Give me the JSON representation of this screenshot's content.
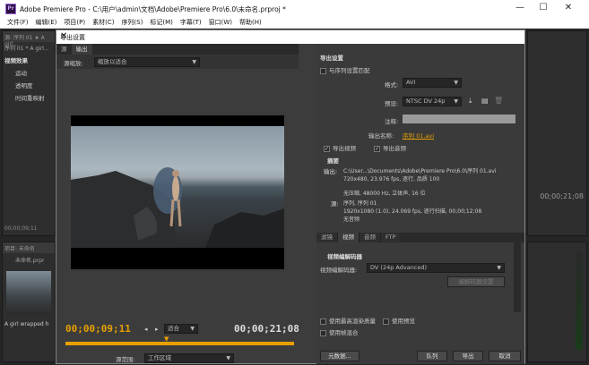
{
  "app": {
    "title": "Adobe Premiere Pro - C:\\用户\\admin\\文档\\Adobe\\Premiere Pro\\6.0\\未命名.prproj *",
    "logo_text": "Pr"
  },
  "window_controls": {
    "minimize": "—",
    "maximize": "☐",
    "close": "✕"
  },
  "menu": [
    "文件(F)",
    "编辑(E)",
    "项目(P)",
    "素材(C)",
    "序列(S)",
    "标记(M)",
    "字幕(T)",
    "窗口(W)",
    "帮助(H)"
  ],
  "background": {
    "panel_tab": "源: 序列 01 ★ A girl...",
    "seq_label": "序列 01 * A girl...",
    "effects_title": "视频效果",
    "effects_items": [
      "运动",
      "透明度",
      "时间重映射"
    ],
    "left_time": "00;00;09;11",
    "right_time": "00;00;21;08",
    "project_tab": "项目: 未命名",
    "project_file": "未命名.prpr",
    "clip_label": "A girl wrapped h"
  },
  "dialog": {
    "title": "导出设置",
    "close": "✕",
    "tabs": [
      "源",
      "输出"
    ],
    "source_scaling_label": "源缩放:",
    "source_scaling_value": "缩放以适合",
    "timecode_in": "00;00;09;11",
    "timecode_out": "00;00;21;08",
    "fit_value": "适合",
    "source_range_label": "源范围:",
    "source_range_value": "工作区域",
    "export_settings": {
      "header": "导出设置",
      "match_sequence": "与序列设置匹配",
      "format_label": "格式:",
      "format_value": "AVI",
      "preset_label": "预设:",
      "preset_value": "NTSC DV 24p",
      "comments_label": "注释:",
      "output_name_label": "输出名称:",
      "output_name_value": "序列 01.avi",
      "export_video": "导出视频",
      "export_audio": "导出音频",
      "summary_header": "摘要",
      "output_label": "输出:",
      "output_line1": "C:\\User...\\Documents\\Adobe\\Premiere Pro\\6.0\\序列 01.avi",
      "output_line2": "720x480, 23.976 fps, 逐行, 品质 100",
      "output_line3": "无压缩, 48000 Hz, 立体声, 16 位",
      "source_label": "源:",
      "source_line1": "序列, 序列 01",
      "source_line2": "1920x1080 (1.0), 24.069 fps, 逐行扫描, 00;00;12;08",
      "source_line3": "无音频"
    },
    "right_tabs": [
      "滤镜",
      "视频",
      "音频",
      "FTP"
    ],
    "video_codec": {
      "header": "视频编解码器",
      "label": "视频编解码器:",
      "value": "DV (24p Advanced)",
      "settings_button": "编解码器设置"
    },
    "use_max_render": "使用最高渲染质量",
    "use_preview": "使用预览",
    "use_frame_blending": "使用帧混合",
    "buttons": {
      "metadata": "元数据...",
      "queue": "队列",
      "export": "导出",
      "cancel": "取消"
    }
  }
}
